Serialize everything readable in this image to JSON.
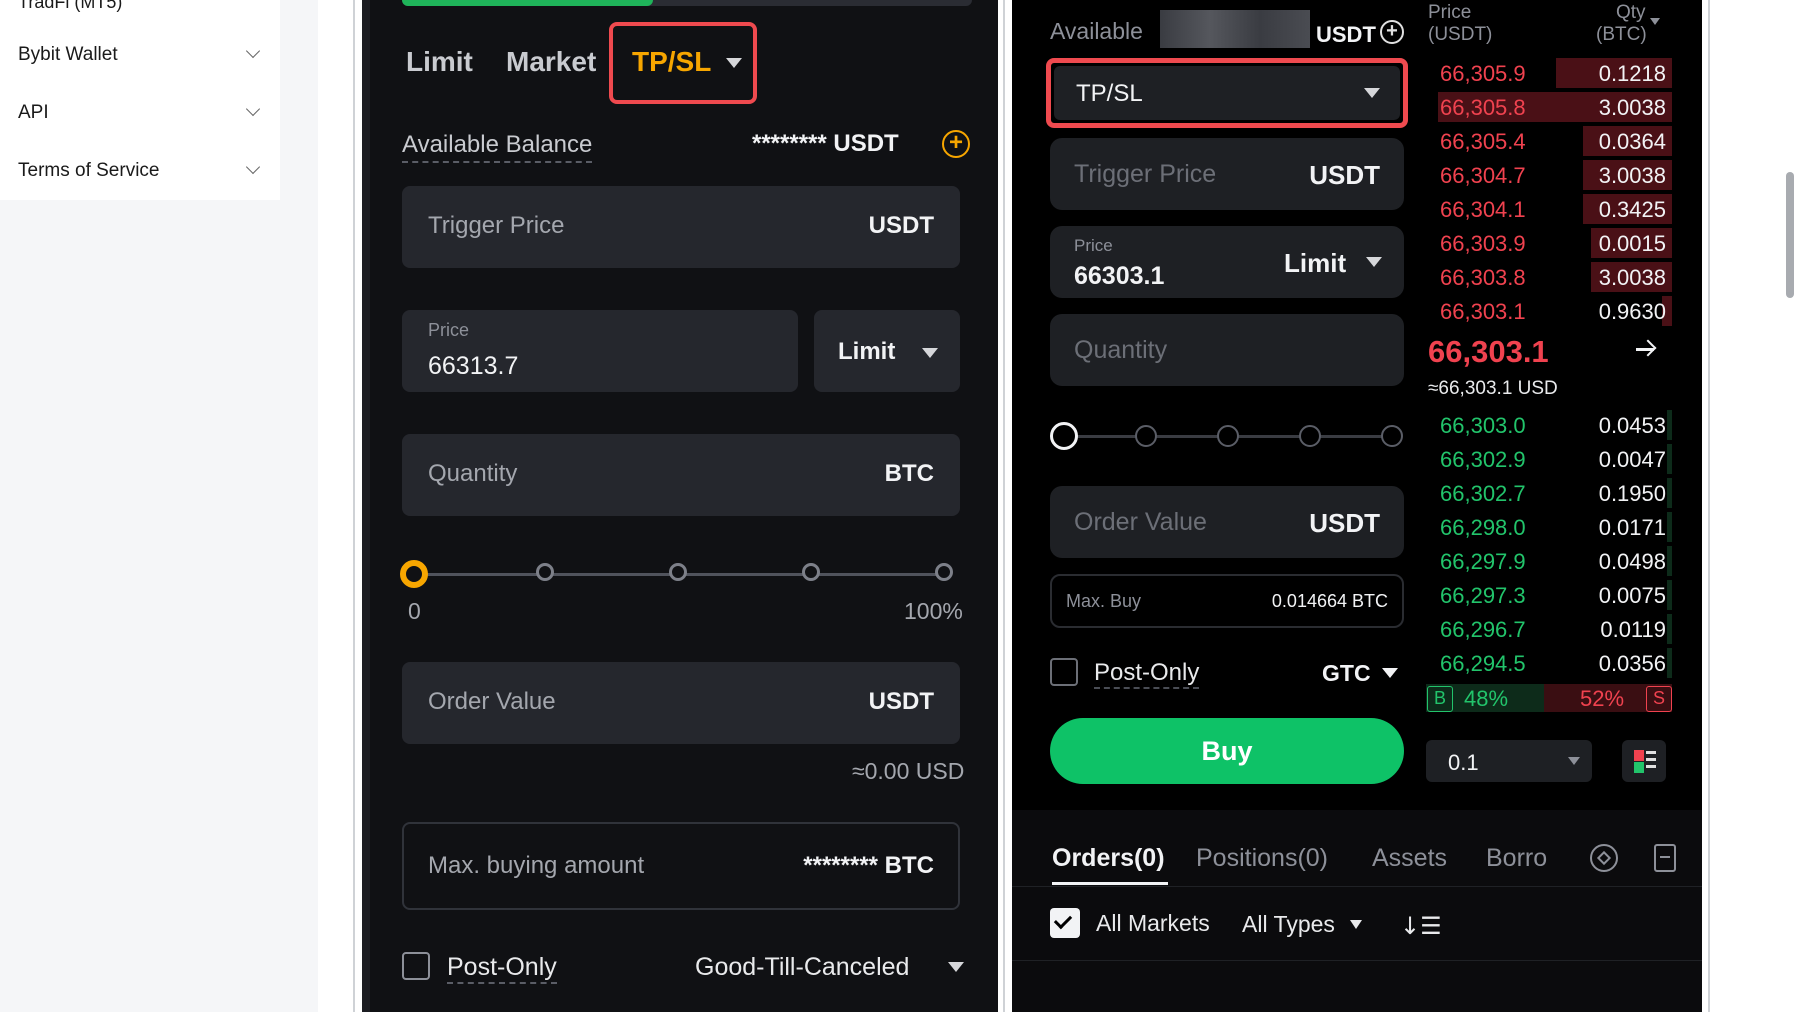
{
  "doc_sidebar": {
    "cut_label": "TradFi (MT5)",
    "items": [
      {
        "label": "Bybit Wallet"
      },
      {
        "label": "API"
      },
      {
        "label": "Terms of Service"
      }
    ]
  },
  "left_panel": {
    "progress_fraction": 0.44,
    "tabs": {
      "limit": "Limit",
      "market": "Market",
      "tpsl": "TP/SL"
    },
    "available_balance_label": "Available Balance",
    "available_balance_value": "******** USDT",
    "trigger_price": {
      "placeholder": "Trigger Price",
      "unit": "USDT"
    },
    "price": {
      "label": "Price",
      "value": "66313.7",
      "type": "Limit"
    },
    "quantity": {
      "placeholder": "Quantity",
      "unit": "BTC"
    },
    "slider": {
      "min_label": "0",
      "max_label": "100%",
      "value_fraction": 0
    },
    "order_value": {
      "placeholder": "Order Value",
      "unit": "USDT"
    },
    "usd_approx": "≈0.00 USD",
    "max_buying": {
      "label": "Max. buying amount",
      "value": "******** BTC"
    },
    "post_only": "Post-Only",
    "time_in_force": "Good-Till-Canceled"
  },
  "right_panel": {
    "available_label": "Available",
    "available_unit": "USDT",
    "order_type": "TP/SL",
    "trigger_price": {
      "placeholder": "Trigger Price",
      "unit": "USDT"
    },
    "price": {
      "label": "Price",
      "value": "66303.1",
      "type": "Limit"
    },
    "quantity": {
      "placeholder": "Quantity"
    },
    "slider_value_fraction": 0,
    "order_value": {
      "placeholder": "Order Value",
      "unit": "USDT"
    },
    "max_buy": {
      "label": "Max. Buy",
      "value": "0.014664 BTC"
    },
    "post_only": "Post-Only",
    "tif": "GTC",
    "buy_button": "Buy",
    "tabs": [
      "Orders(0)",
      "Positions(0)",
      "Assets",
      "Borro"
    ],
    "all_markets": "All Markets",
    "all_types": "All Types"
  },
  "order_book": {
    "price_header": "Price",
    "price_unit": "(USDT)",
    "qty_header": "Qty",
    "qty_unit": "(BTC)",
    "asks": [
      {
        "price": "66,305.9",
        "qty": "0.1218",
        "depth": 0.47
      },
      {
        "price": "66,305.8",
        "qty": "3.0038",
        "depth": 0.95
      },
      {
        "price": "66,305.4",
        "qty": "0.0364",
        "depth": 0.36
      },
      {
        "price": "66,304.7",
        "qty": "3.0038",
        "depth": 0.36
      },
      {
        "price": "66,304.1",
        "qty": "0.3425",
        "depth": 0.36
      },
      {
        "price": "66,303.9",
        "qty": "0.0015",
        "depth": 0.33
      },
      {
        "price": "66,303.8",
        "qty": "3.0038",
        "depth": 0.33
      },
      {
        "price": "66,303.1",
        "qty": "0.9630",
        "depth": 0.04
      }
    ],
    "last_price": "66,303.1",
    "last_price_usd": "≈66,303.1 USD",
    "bids": [
      {
        "price": "66,303.0",
        "qty": "0.0453",
        "depth": 0.02
      },
      {
        "price": "66,302.9",
        "qty": "0.0047",
        "depth": 0.02
      },
      {
        "price": "66,302.7",
        "qty": "0.1950",
        "depth": 0.02
      },
      {
        "price": "66,298.0",
        "qty": "0.0171",
        "depth": 0.02
      },
      {
        "price": "66,297.9",
        "qty": "0.0498",
        "depth": 0.02
      },
      {
        "price": "66,297.3",
        "qty": "0.0075",
        "depth": 0.02
      },
      {
        "price": "66,296.7",
        "qty": "0.0119",
        "depth": 0.02
      },
      {
        "price": "66,294.5",
        "qty": "0.0356",
        "depth": 0.02
      }
    ],
    "buy_ratio": "48%",
    "sell_ratio": "52%",
    "buy_tag": "B",
    "sell_tag": "S",
    "depth_step": "0.1"
  },
  "colors": {
    "accent_orange": "#f7a600",
    "highlight_red": "#ef4a4f",
    "buy_green": "#0ec267",
    "ask_red": "#f0424f",
    "bid_green": "#22c46b"
  },
  "icons": [
    "chevron-down-icon",
    "plus-circle-icon",
    "arrow-right-icon",
    "settings-icon",
    "document-icon",
    "sort-icon",
    "layout-icon",
    "check-icon"
  ]
}
